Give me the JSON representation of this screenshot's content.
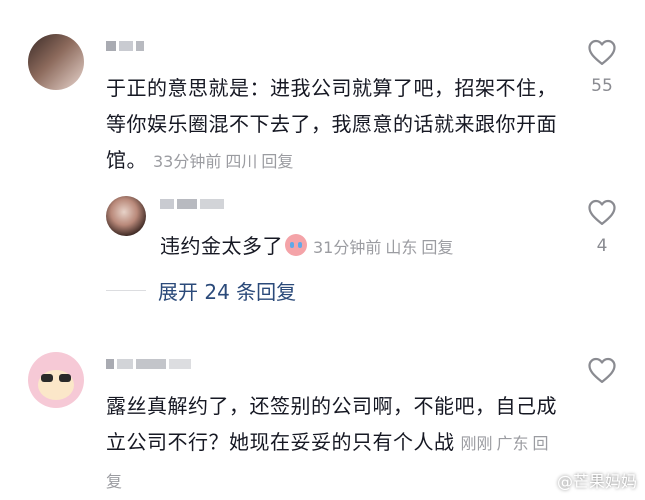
{
  "comments": [
    {
      "text": "于正的意思就是：进我公司就算了吧，招架不住，等你娱乐圈混不下去了，我愿意的话就来跟你开面馆。",
      "time": "33分钟前",
      "location": "四川",
      "reply_label": "回复",
      "likes": "55"
    },
    {
      "text": "违约金太多了",
      "emoji": "crying-face-emoji",
      "time": "31分钟前",
      "location": "山东",
      "reply_label": "回复",
      "likes": "4"
    },
    {
      "text": "露丝真解约了，还签别的公司啊，不能吧，自己成立公司不行？她现在妥妥的只有个人战",
      "time": "刚刚",
      "location": "广东",
      "reply_label": "回复",
      "likes": ""
    }
  ],
  "expand_replies": {
    "label": "展开 24 条回复"
  },
  "watermark": {
    "text": "@芒果妈妈",
    "icon": "weibo-icon"
  },
  "colors": {
    "text": "#161823",
    "meta": "#9b9ca1",
    "link": "#2b4a7a",
    "heart": "#8a8b91"
  }
}
